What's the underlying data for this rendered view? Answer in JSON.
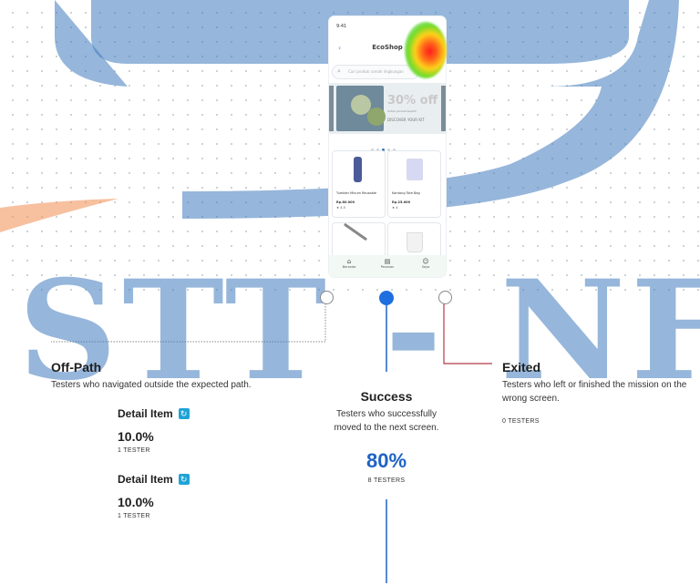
{
  "watermark": {
    "text": "STT - NF"
  },
  "phone": {
    "status_time": "9:41",
    "app_title": "EcoShop",
    "search_placeholder": "Cari produk ramah lingkungan",
    "banner": {
      "headline": "30% off",
      "subline": "Untuk produk terpilih",
      "cta": "DISCOVER YOUR KIT"
    },
    "products": [
      {
        "name": "Tumbler Minum Reusable",
        "price": "Rp.80.000",
        "rating": "4.5"
      },
      {
        "name": "Kantong Tote Bag",
        "price": "Rp.25.000",
        "rating": "4"
      }
    ],
    "tabs": [
      {
        "label": "Beranda",
        "icon": "home-icon"
      },
      {
        "label": "Pesanan",
        "icon": "orders-icon"
      },
      {
        "label": "Saya",
        "icon": "user-icon"
      }
    ]
  },
  "off_path": {
    "title": "Off-Path",
    "description": "Testers who navigated outside the expected path.",
    "items": [
      {
        "label": "Detail Item",
        "percent": "10.0%",
        "count": "1 TESTER",
        "icon": "refresh-icon"
      },
      {
        "label": "Detail Item",
        "percent": "10.0%",
        "count": "1 TESTER",
        "icon": "refresh-icon"
      }
    ]
  },
  "success": {
    "title": "Success",
    "description": "Testers who successfully moved to the next screen.",
    "percent": "80%",
    "count": "8 TESTERS"
  },
  "exited": {
    "title": "Exited",
    "description": "Testers who left or finished the mission on the wrong screen.",
    "count": "0 TESTERS"
  },
  "colors": {
    "success": "#1e63c4",
    "exited_line": "#b23a48",
    "off_path_line": "#888888"
  }
}
